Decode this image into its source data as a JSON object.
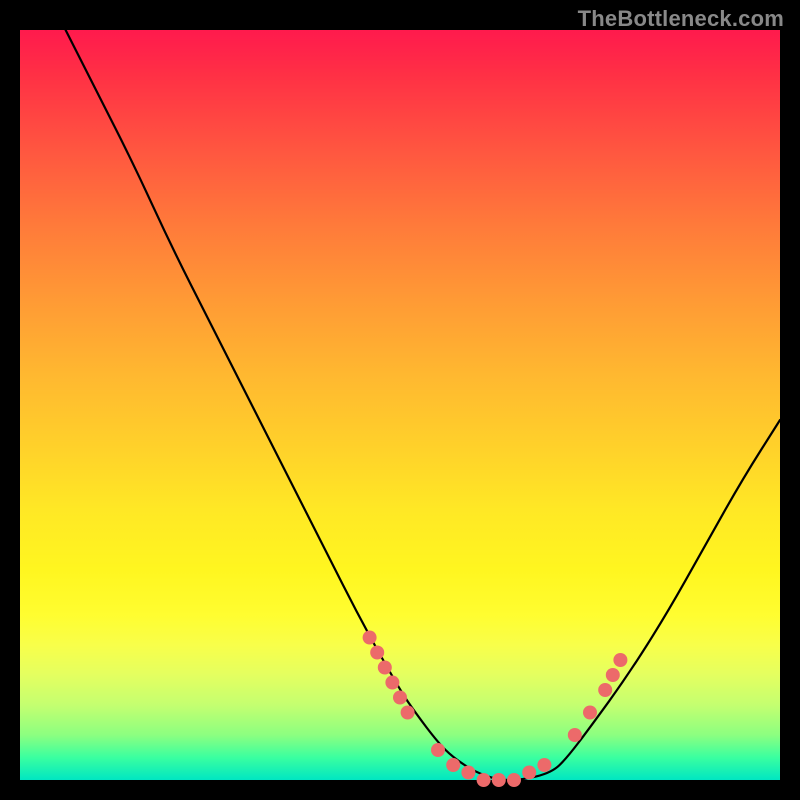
{
  "watermark": "TheBottleneck.com",
  "chart_data": {
    "type": "line",
    "title": "",
    "xlabel": "",
    "ylabel": "",
    "xlim": [
      0,
      100
    ],
    "ylim": [
      0,
      100
    ],
    "grid": false,
    "series": [
      {
        "name": "bottleneck-curve",
        "x": [
          6,
          10,
          15,
          20,
          25,
          30,
          35,
          40,
          45,
          50,
          52,
          55,
          57,
          60,
          63,
          66,
          70,
          72,
          75,
          80,
          85,
          90,
          95,
          100
        ],
        "values": [
          100,
          92,
          82,
          71,
          61,
          51,
          41,
          31,
          21,
          12,
          9,
          5,
          3,
          1,
          0,
          0,
          1,
          3,
          7,
          14,
          22,
          31,
          40,
          48
        ]
      }
    ],
    "markers": {
      "name": "highlight-dots",
      "color": "#ec6a6a",
      "points": [
        {
          "x": 46,
          "y": 19
        },
        {
          "x": 47,
          "y": 17
        },
        {
          "x": 48,
          "y": 15
        },
        {
          "x": 49,
          "y": 13
        },
        {
          "x": 50,
          "y": 11
        },
        {
          "x": 51,
          "y": 9
        },
        {
          "x": 55,
          "y": 4
        },
        {
          "x": 57,
          "y": 2
        },
        {
          "x": 59,
          "y": 1
        },
        {
          "x": 61,
          "y": 0
        },
        {
          "x": 63,
          "y": 0
        },
        {
          "x": 65,
          "y": 0
        },
        {
          "x": 67,
          "y": 1
        },
        {
          "x": 69,
          "y": 2
        },
        {
          "x": 73,
          "y": 6
        },
        {
          "x": 75,
          "y": 9
        },
        {
          "x": 77,
          "y": 12
        },
        {
          "x": 78,
          "y": 14
        },
        {
          "x": 79,
          "y": 16
        }
      ]
    },
    "background_gradient": {
      "top": "#ff1a4d",
      "mid": "#ffe825",
      "bottom": "#00e6c2"
    }
  }
}
